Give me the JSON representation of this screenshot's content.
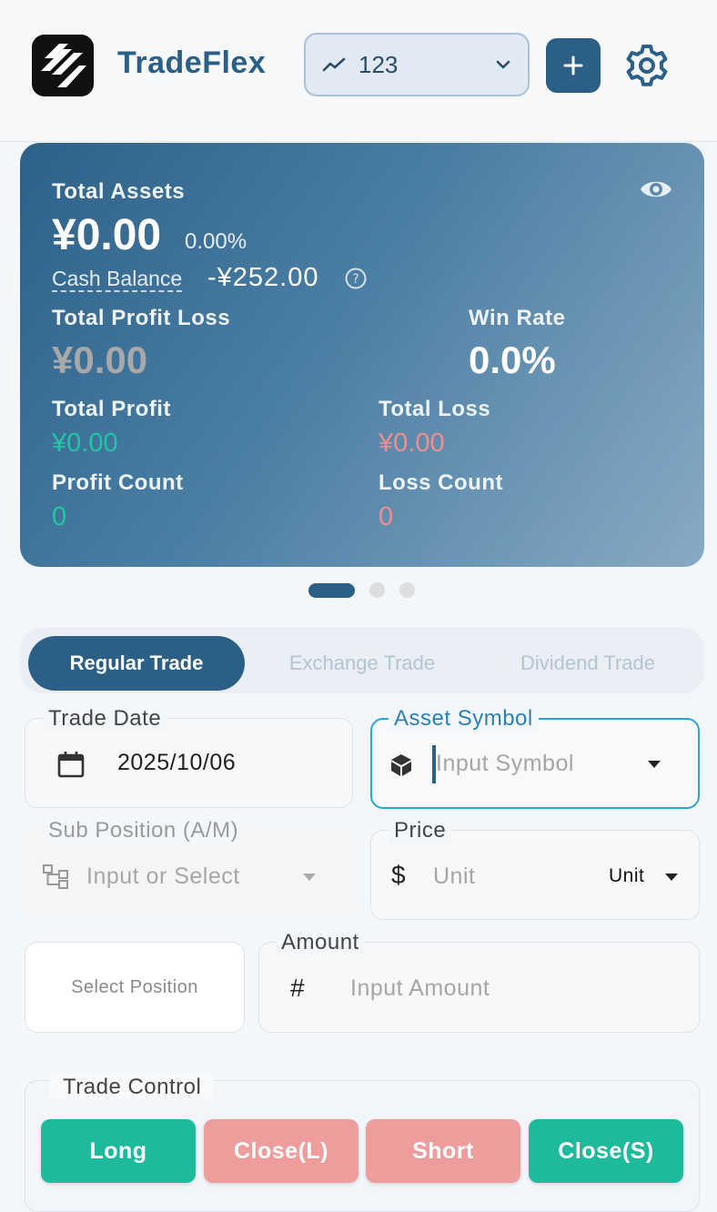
{
  "header": {
    "brand": "TradeFlex",
    "account_value": "123",
    "icons": {
      "logo": "tradeflex-logo-icon",
      "trend": "trend-line-icon",
      "chevron": "chevron-down-icon",
      "add": "plus-icon",
      "settings": "gear-icon"
    }
  },
  "stats": {
    "total_assets_label": "Total Assets",
    "total_assets_value": "¥0.00",
    "total_assets_pct": "0.00%",
    "cash_balance_label": "Cash Balance",
    "cash_balance_value": "-¥252.00",
    "total_pl_label": "Total Profit Loss",
    "total_pl_value": "¥0.00",
    "win_rate_label": "Win Rate",
    "win_rate_value": "0.0%",
    "total_profit_label": "Total Profit",
    "total_profit_value": "¥0.00",
    "total_loss_label": "Total Loss",
    "total_loss_value": "¥0.00",
    "profit_count_label": "Profit Count",
    "profit_count_value": "0",
    "loss_count_label": "Loss Count",
    "loss_count_value": "0",
    "colors": {
      "profit": "#1fc7a3",
      "loss": "#f28d8d",
      "neutral": "#a9a9a9"
    }
  },
  "carousel": {
    "pages": 3,
    "active": 1
  },
  "tabs": [
    {
      "label": "Regular Trade",
      "active": true
    },
    {
      "label": "Exchange Trade",
      "active": false
    },
    {
      "label": "Dividend Trade",
      "active": false
    }
  ],
  "form": {
    "trade_date_label": "Trade Date",
    "trade_date_value": "2025/10/06",
    "asset_symbol_label": "Asset Symbol",
    "asset_symbol_placeholder": "Input Symbol",
    "sub_position_label": "Sub Position (A/M)",
    "sub_position_placeholder": "Input or Select",
    "price_label": "Price",
    "price_placeholder": "Unit",
    "price_unit": "Unit",
    "select_position": "Select Position",
    "amount_label": "Amount",
    "amount_placeholder": "Input Amount",
    "currency_symbol": "$",
    "hash_symbol": "#"
  },
  "control": {
    "title": "Trade Control",
    "buttons": [
      "Long",
      "Close(L)",
      "Short",
      "Close(S)"
    ]
  }
}
